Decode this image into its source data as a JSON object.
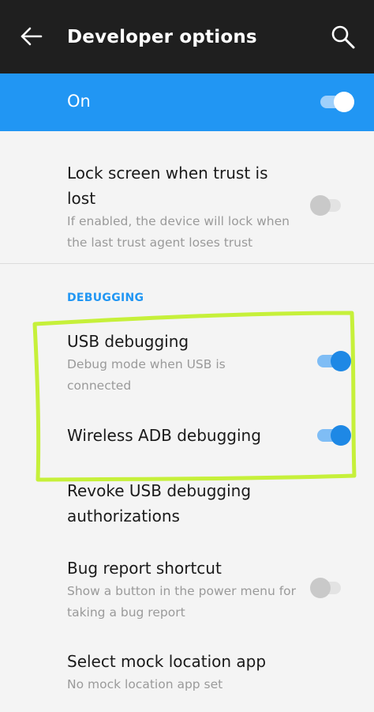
{
  "header": {
    "title": "Developer options",
    "back_icon": "arrow-left-icon",
    "search_icon": "search-icon",
    "background": "#1f1f1f"
  },
  "master_switch": {
    "label": "On",
    "state": "on",
    "background": "#2196f3"
  },
  "preferences_top": [
    {
      "title": "Lock screen when trust is lost",
      "summary": "If enabled, the device will lock when the last trust agent loses trust",
      "toggle": "off"
    }
  ],
  "section": {
    "header": "DEBUGGING",
    "color": "#2196f3"
  },
  "debugging": [
    {
      "title": "USB debugging",
      "summary": "Debug mode when USB is connected",
      "toggle": "on"
    },
    {
      "title": "Wireless ADB debugging",
      "summary": "",
      "toggle": "on"
    },
    {
      "title": "Revoke USB debugging authorizations",
      "summary": ""
    },
    {
      "title": "Bug report shortcut",
      "summary": "Show a button in the power menu for taking a bug report",
      "toggle": "off"
    },
    {
      "title": "Select mock location app",
      "summary": "No mock location app set"
    }
  ],
  "annotation": {
    "highlight_color": "#c6f03a"
  }
}
